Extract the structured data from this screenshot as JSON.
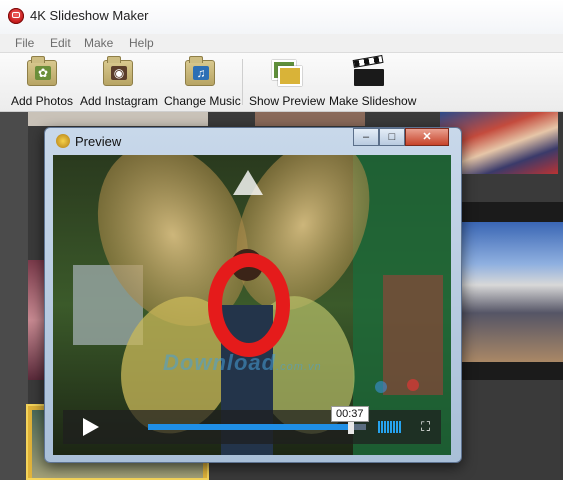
{
  "app": {
    "title": "4K Slideshow Maker"
  },
  "menu": [
    "File",
    "Edit",
    "Make",
    "Help"
  ],
  "toolbar": {
    "add_photos": "Add Photos",
    "add_instagram": "Add Instagram",
    "change_music": "Change Music",
    "show_preview": "Show Preview",
    "make_slideshow": "Make Slideshow"
  },
  "preview": {
    "title": "Preview",
    "minimize": "–",
    "maximize": "□",
    "close": "✕",
    "time": "00:37",
    "progress": 0.93,
    "watermark_main": "Download",
    "watermark_sub": ".com.vn"
  },
  "colors": {
    "accent": "#1f8fe6",
    "app_icon": "#c81c1c"
  }
}
